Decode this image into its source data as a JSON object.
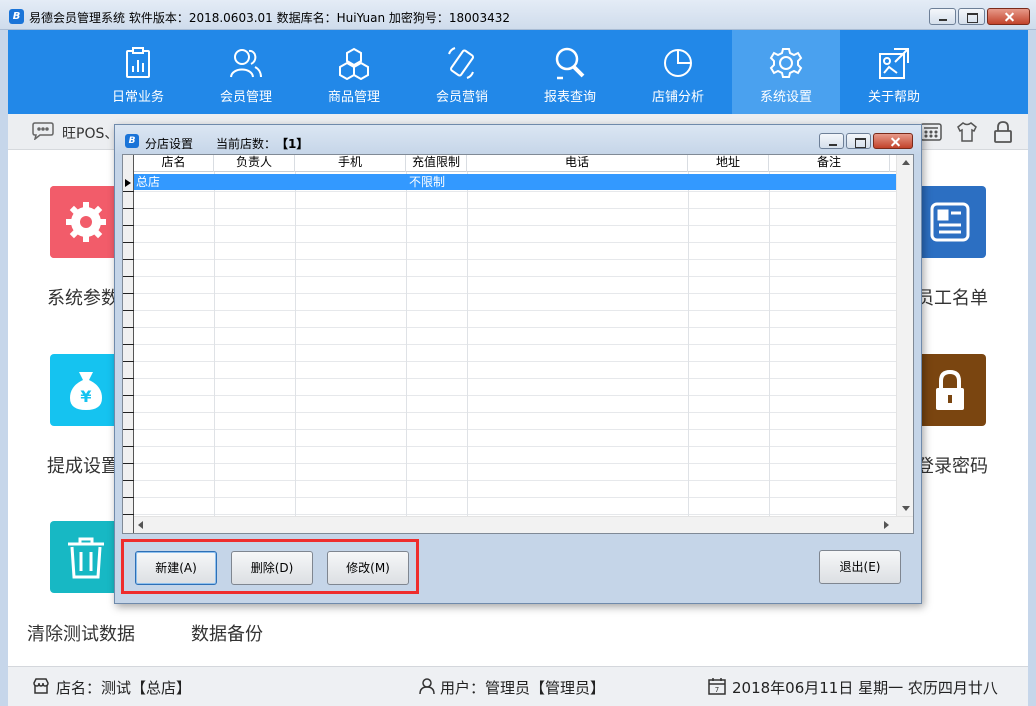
{
  "window": {
    "title": "易德会员管理系统   软件版本：2018.0603.01   数据库名：HuiYuan   加密狗号：18003432",
    "icon_glyph": "B"
  },
  "nav": [
    {
      "label": "日常业务",
      "icon": "clipboard-chart-icon"
    },
    {
      "label": "会员管理",
      "icon": "users-icon"
    },
    {
      "label": "商品管理",
      "icon": "boxes-icon"
    },
    {
      "label": "会员营销",
      "icon": "phone-icon"
    },
    {
      "label": "报表查询",
      "icon": "magnifier-icon"
    },
    {
      "label": "店铺分析",
      "icon": "pie-chart-icon"
    },
    {
      "label": "系统设置",
      "icon": "gear-icon",
      "active": true
    },
    {
      "label": "关于帮助",
      "icon": "help-icon"
    }
  ],
  "strip": {
    "text": "旺POS、"
  },
  "tiles": {
    "system_params": "系统参数",
    "commission": "提成设置",
    "clear_test": "清除测试数据",
    "backup": "数据备份",
    "staff_list": "员工名单",
    "login_password": "登录密码",
    "gear_tile_color": "#f25c6a",
    "money_tile_color": "#15c3f0",
    "trash_tile_color": "#17b8c4",
    "doc_tile_color": "#2c6fc2",
    "lock_tile_color": "#7a4510"
  },
  "dialog": {
    "title": "分店设置",
    "count_label": "当前店数：",
    "count_value": "【1】",
    "columns": [
      "店名",
      "负责人",
      "手机",
      "充值限制",
      "电话",
      "地址",
      "备注"
    ],
    "rows": [
      {
        "name": "总店",
        "manager": "",
        "mobile": "",
        "limit": "不限制",
        "phone": "",
        "address": "",
        "note": ""
      }
    ],
    "buttons": {
      "new": "新建(A)",
      "delete": "删除(D)",
      "edit": "修改(M)",
      "exit": "退出(E)"
    }
  },
  "status": {
    "store": "店名：测试【总店】",
    "user": "用户：管理员【管理员】",
    "date": "2018年06月11日 星期一 农历四月廿八"
  },
  "colors": {
    "nav_bg": "#2288e8",
    "nav_active": "#4aa1ef",
    "selection": "#3399ff",
    "highlight_border": "#ee2d2d"
  }
}
